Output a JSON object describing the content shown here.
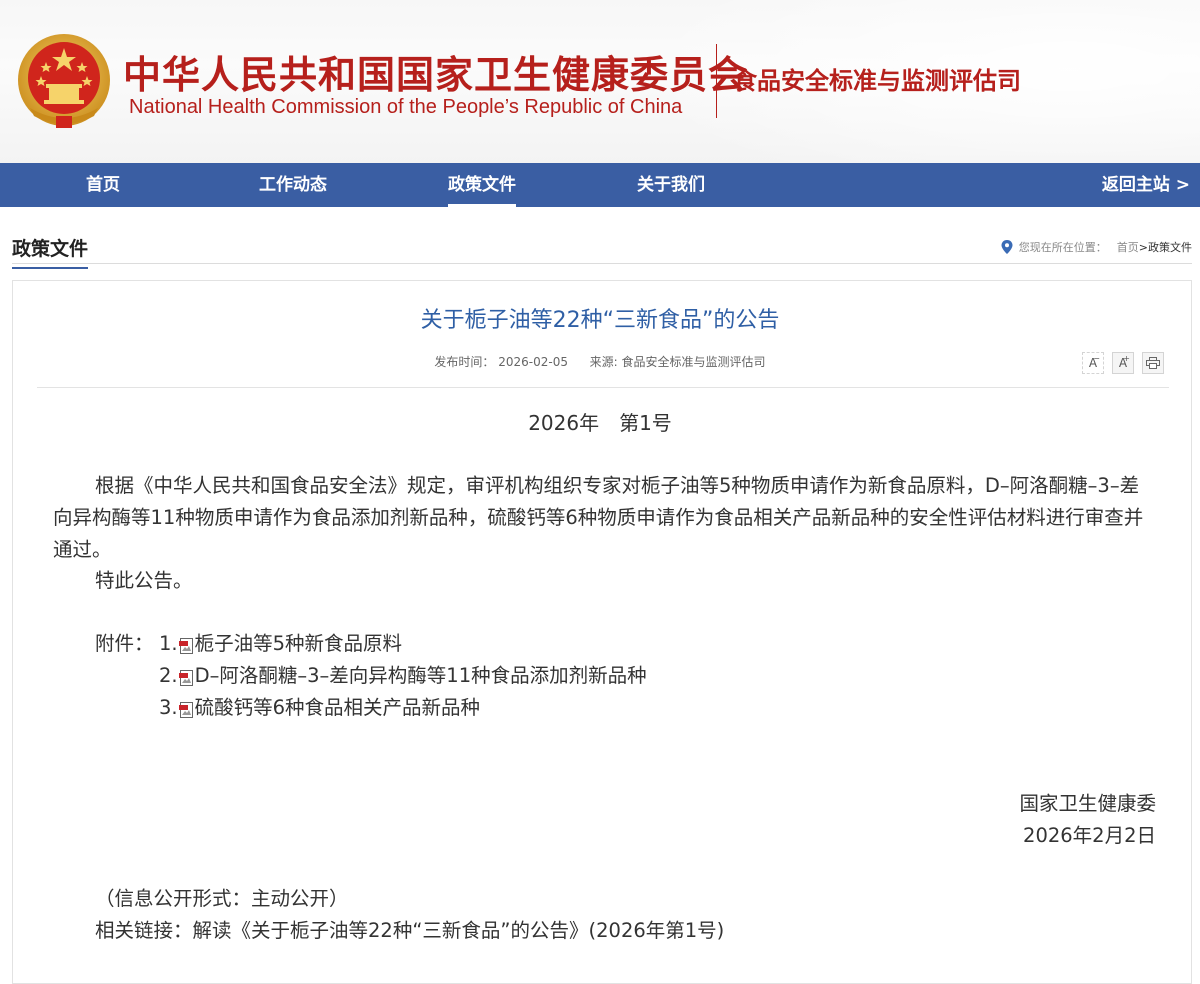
{
  "header": {
    "title_cn": "中华人民共和国国家卫生健康委员会",
    "title_en": "National Health Commission of the People’s  Republic of China",
    "department": "食品安全标准与监测评估司"
  },
  "nav": {
    "items": [
      {
        "label": "首页"
      },
      {
        "label": "工作动态"
      },
      {
        "label": "政策文件"
      },
      {
        "label": "关于我们"
      }
    ],
    "active": "政策文件",
    "back_label": "返回主站 >"
  },
  "section": {
    "title": "政策文件",
    "location_label": "您现在所在位置：",
    "breadcrumb_home": "首页",
    "breadcrumb_sep": ">",
    "breadcrumb_current": "政策文件"
  },
  "article": {
    "title": "关于栀子油等22种“三新食品”的公告",
    "publish_label": "发布时间：",
    "publish_date": "2026-02-05",
    "source_label": "来源:",
    "source": "食品安全标准与监测评估司",
    "tools": {
      "font_smaller": "A",
      "font_larger": "A",
      "font_larger_sup": "+"
    },
    "doc_number": "2026年　第1号",
    "body": "根据《中华人民共和国食品安全法》规定，审评机构组织专家对栀子油等5种物质申请作为新食品原料，D–阿洛酮糖–3–差向异构酶等11种物质申请作为食品添加剂新品种，硫酸钙等6种物质申请作为食品相关产品新品种的安全性评估材料进行审查并通过。",
    "notice": "特此公告。",
    "attachments_label": "附件：",
    "attachments": [
      {
        "num": "1.",
        "title": "栀子油等5种新食品原料"
      },
      {
        "num": "2.",
        "title": "D–阿洛酮糖–3–差向异构酶等11种食品添加剂新品种"
      },
      {
        "num": "3.",
        "title": "硫酸钙等6种食品相关产品新品种"
      }
    ],
    "signer": "国家卫生健康委",
    "sign_date": "2026年2月2日",
    "disclosure": "（信息公开形式：主动公开）",
    "related_label": "相关链接：",
    "related_link": "解读《关于栀子油等22种“三新食品”的公告》(2026年第1号)"
  },
  "colors": {
    "brand_red": "#b6201c",
    "nav_blue": "#3a5ea3",
    "title_blue": "#2f5fa5"
  }
}
